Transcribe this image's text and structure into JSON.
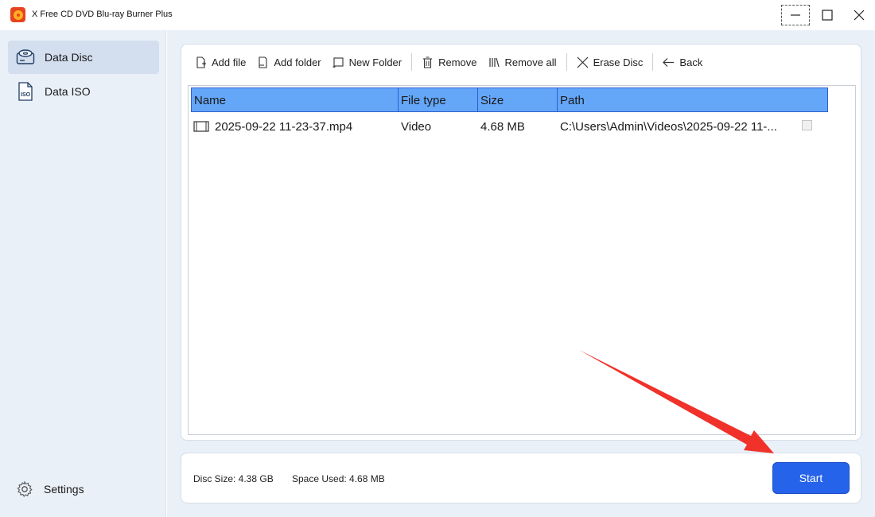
{
  "app": {
    "title": "X Free CD DVD Blu-ray Burner Plus"
  },
  "sidebar": {
    "items": [
      {
        "label": "Data Disc",
        "icon": "data-disc-icon",
        "active": true
      },
      {
        "label": "Data ISO",
        "icon": "iso-icon",
        "active": false
      }
    ],
    "settings_label": "Settings"
  },
  "toolbar": {
    "add_file": "Add file",
    "add_folder": "Add folder",
    "new_folder": "New Folder",
    "remove": "Remove",
    "remove_all": "Remove all",
    "erase_disc": "Erase Disc",
    "back": "Back"
  },
  "table": {
    "columns": [
      "Name",
      "File type",
      "Size",
      "Path"
    ],
    "rows": [
      {
        "name": "2025-09-22 11-23-37.mp4",
        "type": "Video",
        "size": "4.68 MB",
        "path": "C:\\Users\\Admin\\Videos\\2025-09-22 11-..."
      }
    ]
  },
  "footer": {
    "disc_size": "Disc Size: 4.38 GB",
    "space_used": "Space Used: 4.68 MB",
    "start_label": "Start"
  },
  "colors": {
    "accent": "#2563eb",
    "header": "#64a6f8",
    "sidebar_bg": "#eaf0f8",
    "annotation_arrow": "#f0322a"
  }
}
